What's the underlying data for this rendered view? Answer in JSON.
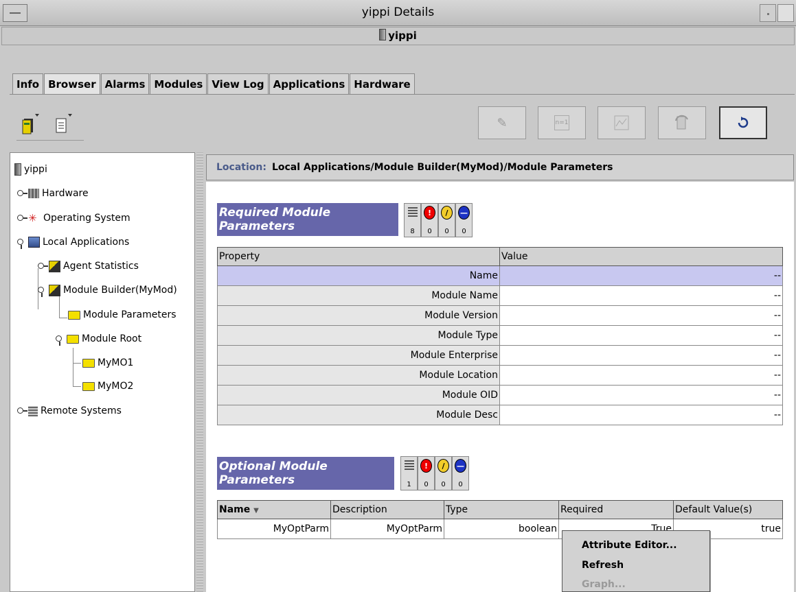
{
  "window": {
    "title": "yippi Details",
    "host_label": "yippi"
  },
  "tabs": [
    {
      "label": "Info"
    },
    {
      "label": "Browser",
      "active": true
    },
    {
      "label": "Alarms"
    },
    {
      "label": "Modules"
    },
    {
      "label": "View Log"
    },
    {
      "label": "Applications"
    },
    {
      "label": "Hardware"
    }
  ],
  "toolbar": {
    "right_buttons": [
      {
        "icon": "edit-icon",
        "enabled": false
      },
      {
        "icon": "n-equals-1-icon",
        "label": "n=1",
        "enabled": false
      },
      {
        "icon": "graph-icon",
        "enabled": false
      },
      {
        "icon": "module-refresh-icon",
        "enabled": false
      },
      {
        "icon": "refresh-icon",
        "enabled": true
      }
    ]
  },
  "tree": {
    "root": "yippi",
    "items": [
      {
        "label": "Hardware"
      },
      {
        "label": "Operating System"
      },
      {
        "label": "Local Applications"
      },
      {
        "label": "Agent Statistics"
      },
      {
        "label": "Module Builder(MyMod)"
      },
      {
        "label": "Module Parameters"
      },
      {
        "label": "Module Root"
      },
      {
        "label": "MyMO1"
      },
      {
        "label": "MyMO2"
      },
      {
        "label": "Remote Systems"
      }
    ]
  },
  "location": {
    "label": "Location:",
    "path": "Local Applications/Module Builder(MyMod)/Module Parameters"
  },
  "required": {
    "title": "Required Module Parameters",
    "badge_counts": [
      "8",
      "0",
      "0",
      "0"
    ],
    "columns": [
      "Property",
      "Value"
    ],
    "rows": [
      {
        "property": "Name",
        "value": "--"
      },
      {
        "property": "Module Name",
        "value": "--"
      },
      {
        "property": "Module Version",
        "value": "--"
      },
      {
        "property": "Module Type",
        "value": "--"
      },
      {
        "property": "Module Enterprise",
        "value": "--"
      },
      {
        "property": "Module Location",
        "value": "--"
      },
      {
        "property": "Module OID",
        "value": "--"
      },
      {
        "property": "Module Desc",
        "value": "--"
      }
    ]
  },
  "optional": {
    "title": "Optional Module Parameters",
    "badge_counts": [
      "1",
      "0",
      "0",
      "0"
    ],
    "columns": [
      "Name",
      "Description",
      "Type",
      "Required",
      "Default Value(s)"
    ],
    "sort_indicator": "▼",
    "rows": [
      {
        "name": "MyOptParm",
        "description": "MyOptParm",
        "type": "boolean",
        "required": "True",
        "default": "true"
      }
    ]
  },
  "context_menu": {
    "items": [
      {
        "label": "Attribute Editor...",
        "enabled": true
      },
      {
        "label": "Refresh",
        "enabled": true
      },
      {
        "label": "Graph...",
        "enabled": false
      }
    ]
  },
  "colors": {
    "section_header": "#6666aa",
    "selected_row": "#c8c8f0",
    "critical": "#e00000",
    "warning": "#f1cc2a",
    "info": "#1d33c4"
  }
}
